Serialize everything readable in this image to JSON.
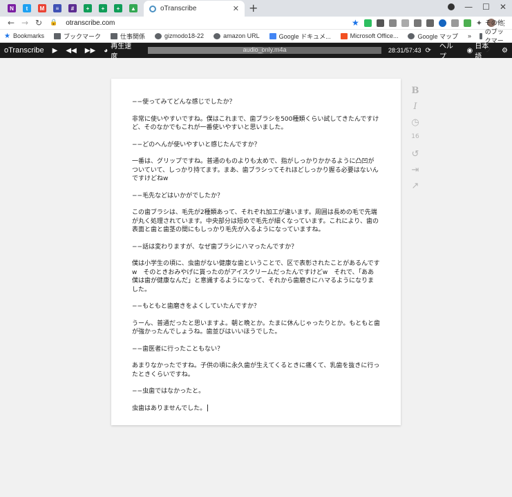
{
  "browser": {
    "active_tab_title": "oTranscribe",
    "url": "otranscribe.com",
    "pinned_tab_colors": [
      "#7b1fa2",
      "#1da1f2",
      "#ea4335",
      "#3f51b5",
      "#5c2d91",
      "#0f9d58",
      "#0f9d58",
      "#0f9d58",
      "#34a853"
    ],
    "bookmarks": [
      {
        "label": "Bookmarks",
        "icon": "star-icon",
        "color": "#1a73e8"
      },
      {
        "label": "ブックマーク",
        "icon": "folder-icon",
        "color": "#5f6368"
      },
      {
        "label": "仕事関係",
        "icon": "folder-icon",
        "color": "#5f6368"
      },
      {
        "label": "gizmodo18-22",
        "icon": "globe-icon",
        "color": "#5f6368"
      },
      {
        "label": "amazon URL",
        "icon": "globe-icon",
        "color": "#5f6368"
      },
      {
        "label": "Google ドキュメ...",
        "icon": "docs-icon",
        "color": "#4285f4"
      },
      {
        "label": "Microsoft Office...",
        "icon": "office-icon",
        "color": "#f25022"
      },
      {
        "label": "Google マップ",
        "icon": "globe-icon",
        "color": "#5f6368"
      }
    ],
    "other_bookmarks": "その他のブックマーク",
    "more": "»"
  },
  "app": {
    "brand": "oTranscribe",
    "speed_label": "再生速度",
    "file_name": "audio_only.m4a",
    "time": "28:31/57:43",
    "progress": 0.494,
    "help_label": "ヘルプ",
    "language_label": "日本語"
  },
  "sidebar": {
    "word_count": "16"
  },
  "transcript": [
    "−−使ってみてどんな感じでしたか？",
    "非常に使いやすいですね。僕はこれまで、歯ブラシを500種類くらい試してきたんですけど、そのなかでもこれが一番使いやすいと思いました。",
    "−−どのへんが使いやすいと感じたんですか？",
    "一番は、グリップですね。普通のものよりも太めで、指がしっかりかかるように凸凹がついていて、しっかり持てます。まあ、歯ブラシってそれほどしっかり握る必要はないんですけどねw",
    "−−毛先などはいかがでしたか？",
    "この歯ブラシは、毛先が2種類あって、それぞれ加工が違います。周囲は長めの毛で先端が丸く処理されています。中央部分は短めで毛先が細くなっています。これにより、歯の表面と歯と歯茎の間にもしっかり毛先が入るようになっていますね。",
    "−−話は変わりますが、なぜ歯ブラシにハマったんですか？",
    "僕は小学生の頃に、虫歯がない健康な歯ということで、区で表彰されたことがあるんですw　そのときおみやげに貰ったのがアイスクリームだったんですけどw　それで、「ああ僕は歯が健康なんだ」と意識するようになって、それから歯磨きにハマるようになりました。",
    "−−もともと歯磨きをよくしていたんですか？",
    "うーん、普通だったと思いますよ。朝と晩とか。たまに休んじゃったりとか。もともと歯が強かったんでしょうね。歯並びはいいほうでした。",
    "−−歯医者に行ったこともない？",
    "あまりなかったですね。子供の頃に永久歯が生えてくるときに痛くて、乳歯を抜きに行ったときくらいですね。",
    "−−虫歯ではなかったと。",
    "虫歯はありませんでした。"
  ]
}
